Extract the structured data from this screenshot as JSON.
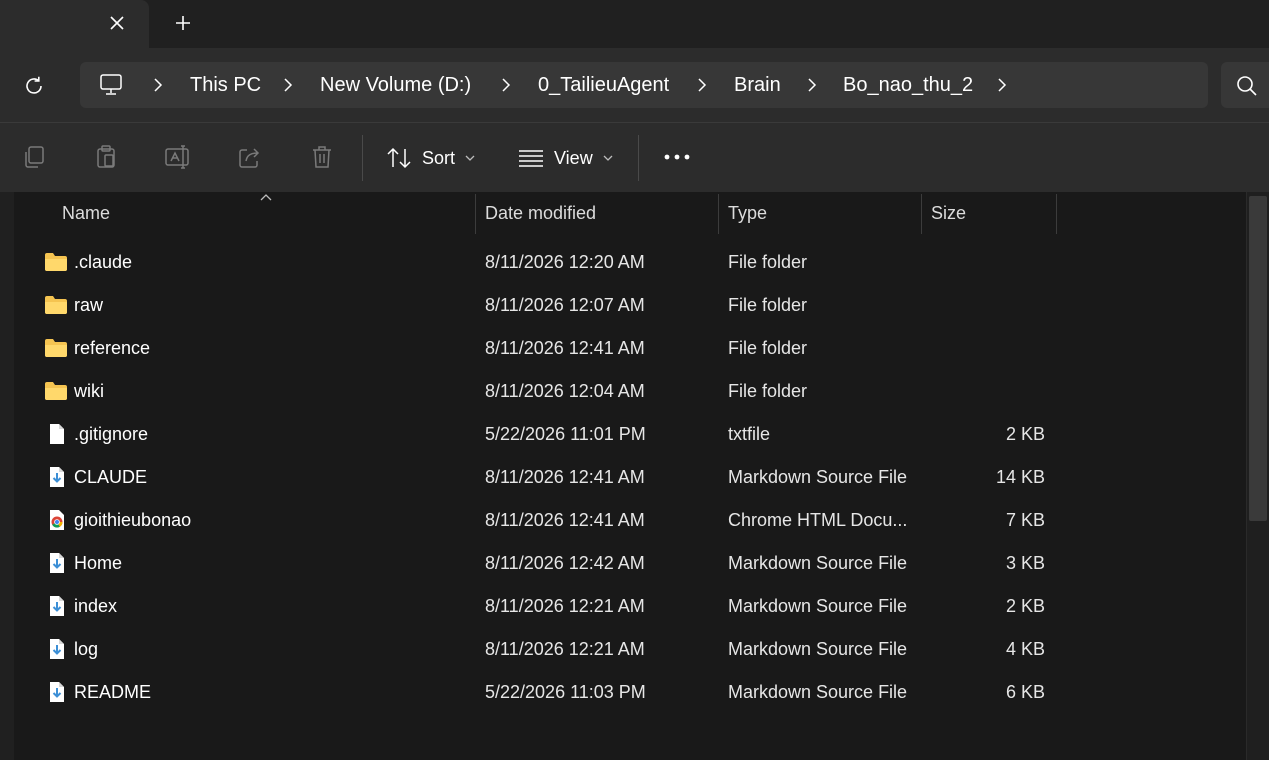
{
  "window": {
    "new_tab_symbol": "+",
    "close_tab_symbol": "×"
  },
  "breadcrumb": [
    "This PC",
    "New Volume (D:)",
    "0_TailieuAgent",
    "Brain",
    "Bo_nao_thu_2"
  ],
  "commandbar": {
    "sort_label": "Sort",
    "view_label": "View"
  },
  "columns": {
    "name": "Name",
    "date": "Date modified",
    "type": "Type",
    "size": "Size"
  },
  "files": [
    {
      "name": ".claude",
      "date": "8/11/2026 12:20 AM",
      "type": "File folder",
      "size": "",
      "icon": "folder-icon"
    },
    {
      "name": "raw",
      "date": "8/11/2026 12:07 AM",
      "type": "File folder",
      "size": "",
      "icon": "folder-icon"
    },
    {
      "name": "reference",
      "date": "8/11/2026 12:41 AM",
      "type": "File folder",
      "size": "",
      "icon": "folder-icon"
    },
    {
      "name": "wiki",
      "date": "8/11/2026 12:04 AM",
      "type": "File folder",
      "size": "",
      "icon": "folder-icon"
    },
    {
      "name": ".gitignore",
      "date": "5/22/2026 11:01 PM",
      "type": "txtfile",
      "size": "2 KB",
      "icon": "text-file-icon"
    },
    {
      "name": "CLAUDE",
      "date": "8/11/2026 12:41 AM",
      "type": "Markdown Source File",
      "size": "14 KB",
      "icon": "markdown-file-icon"
    },
    {
      "name": "gioithieubonao",
      "date": "8/11/2026 12:41 AM",
      "type": "Chrome HTML Docu...",
      "size": "7 KB",
      "icon": "chrome-html-icon"
    },
    {
      "name": "Home",
      "date": "8/11/2026 12:42 AM",
      "type": "Markdown Source File",
      "size": "3 KB",
      "icon": "markdown-file-icon"
    },
    {
      "name": "index",
      "date": "8/11/2026 12:21 AM",
      "type": "Markdown Source File",
      "size": "2 KB",
      "icon": "markdown-file-icon"
    },
    {
      "name": "log",
      "date": "8/11/2026 12:21 AM",
      "type": "Markdown Source File",
      "size": "4 KB",
      "icon": "markdown-file-icon"
    },
    {
      "name": "README",
      "date": "5/22/2026 11:03 PM",
      "type": "Markdown Source File",
      "size": "6 KB",
      "icon": "markdown-file-icon"
    }
  ],
  "colors": {
    "folder": "#f5c451",
    "markdown_arrow": "#3c8fd6",
    "background": "#191919",
    "toolbar": "#2c2c2c"
  }
}
